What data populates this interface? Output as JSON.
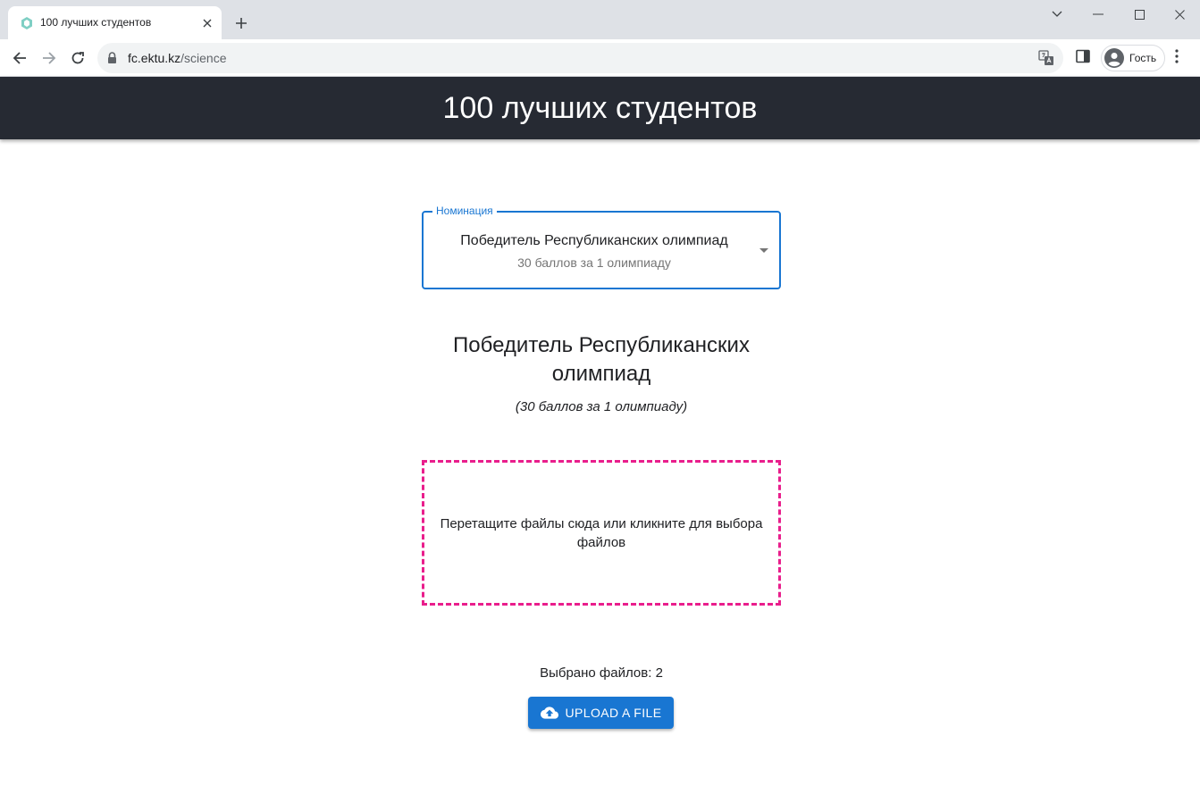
{
  "browser": {
    "tab": {
      "title": "100 лучших студентов",
      "favicon": "app-favicon"
    },
    "url": {
      "host": "fc.ektu.kz",
      "path": "/science"
    },
    "profile": {
      "label": "Гость"
    }
  },
  "header": {
    "title": "100 лучших студентов"
  },
  "nomination_select": {
    "label": "Номинация",
    "selected_title": "Победитель Республиканских олимпиад",
    "selected_subtitle": "30 баллов за 1 олимпиаду"
  },
  "section": {
    "title": "Победитель Республиканских олимпиад",
    "subtitle": "(30 баллов за 1 олимпиаду)"
  },
  "dropzone": {
    "text": "Перетащите файлы сюда или кликните для выбора файлов"
  },
  "files": {
    "selected_text": "Выбрано файлов: 2"
  },
  "upload_button": {
    "label": "UPLOAD A FILE",
    "icon": "cloud-upload-icon"
  },
  "colors": {
    "header_bg": "#262a33",
    "accent": "#1976d2",
    "dropzone_border": "#e91e8c"
  }
}
